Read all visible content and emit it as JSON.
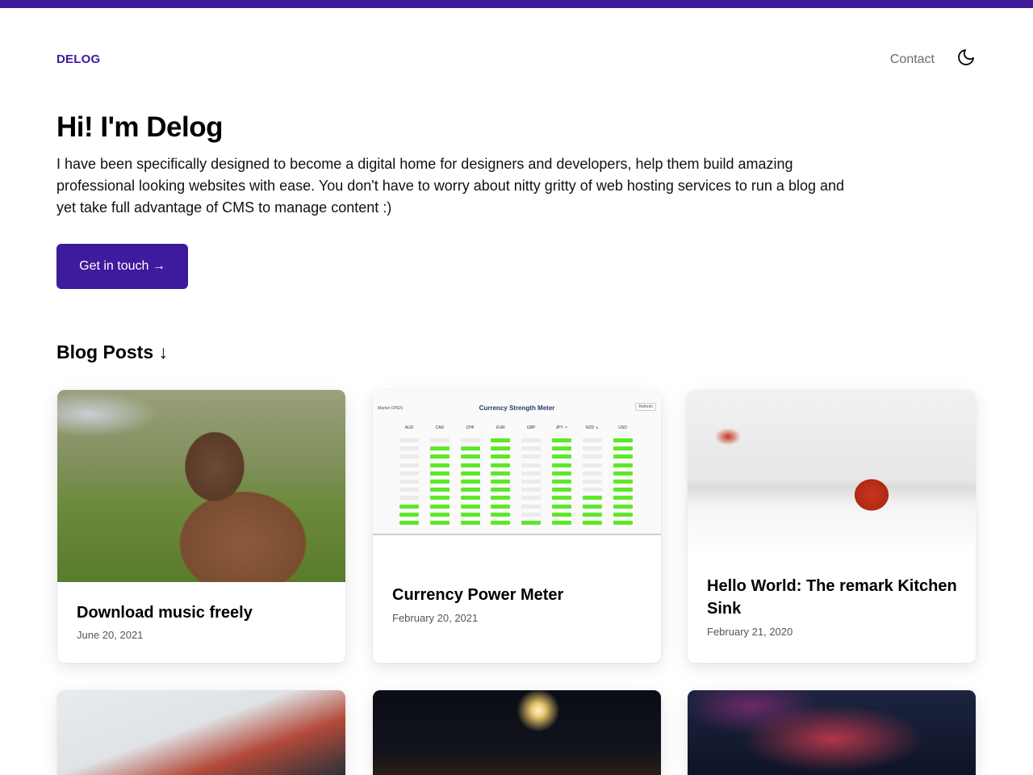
{
  "brand": {
    "logo": "DELOG",
    "accent": "#3e1a9c"
  },
  "nav": {
    "contact": "Contact",
    "theme_icon": "moon-icon"
  },
  "hero": {
    "title": "Hi! I'm Delog",
    "description": "I have been specifically designed to become a digital home for designers and developers, help them build amazing professional looking websites with ease. You don't have to worry about nitty gritty of web hosting services to run a blog and yet take full advantage of CMS to manage content :)",
    "cta": "Get in touch →"
  },
  "blog": {
    "heading": "Blog Posts ↓",
    "posts": [
      {
        "title": "Download music freely",
        "date": "June 20, 2021"
      },
      {
        "title": "Currency Power Meter",
        "date": "February 20, 2021"
      },
      {
        "title": "Hello World: The remark Kitchen Sink",
        "date": "February 21, 2020"
      }
    ]
  },
  "meter_thumb": {
    "title": "Currency Strength Meter",
    "status": "Market OPEN",
    "refresh": "Refresh",
    "currencies": [
      "AUD",
      "CAD",
      "CHF",
      "EUR",
      "GBP",
      "JPY ↗",
      "NZD ↘",
      "USD"
    ],
    "levels": [
      3,
      10,
      10,
      11,
      1,
      11,
      4,
      11
    ],
    "segments": 11,
    "on_color": "#5ee82a",
    "off_color": "#ebebeb"
  }
}
